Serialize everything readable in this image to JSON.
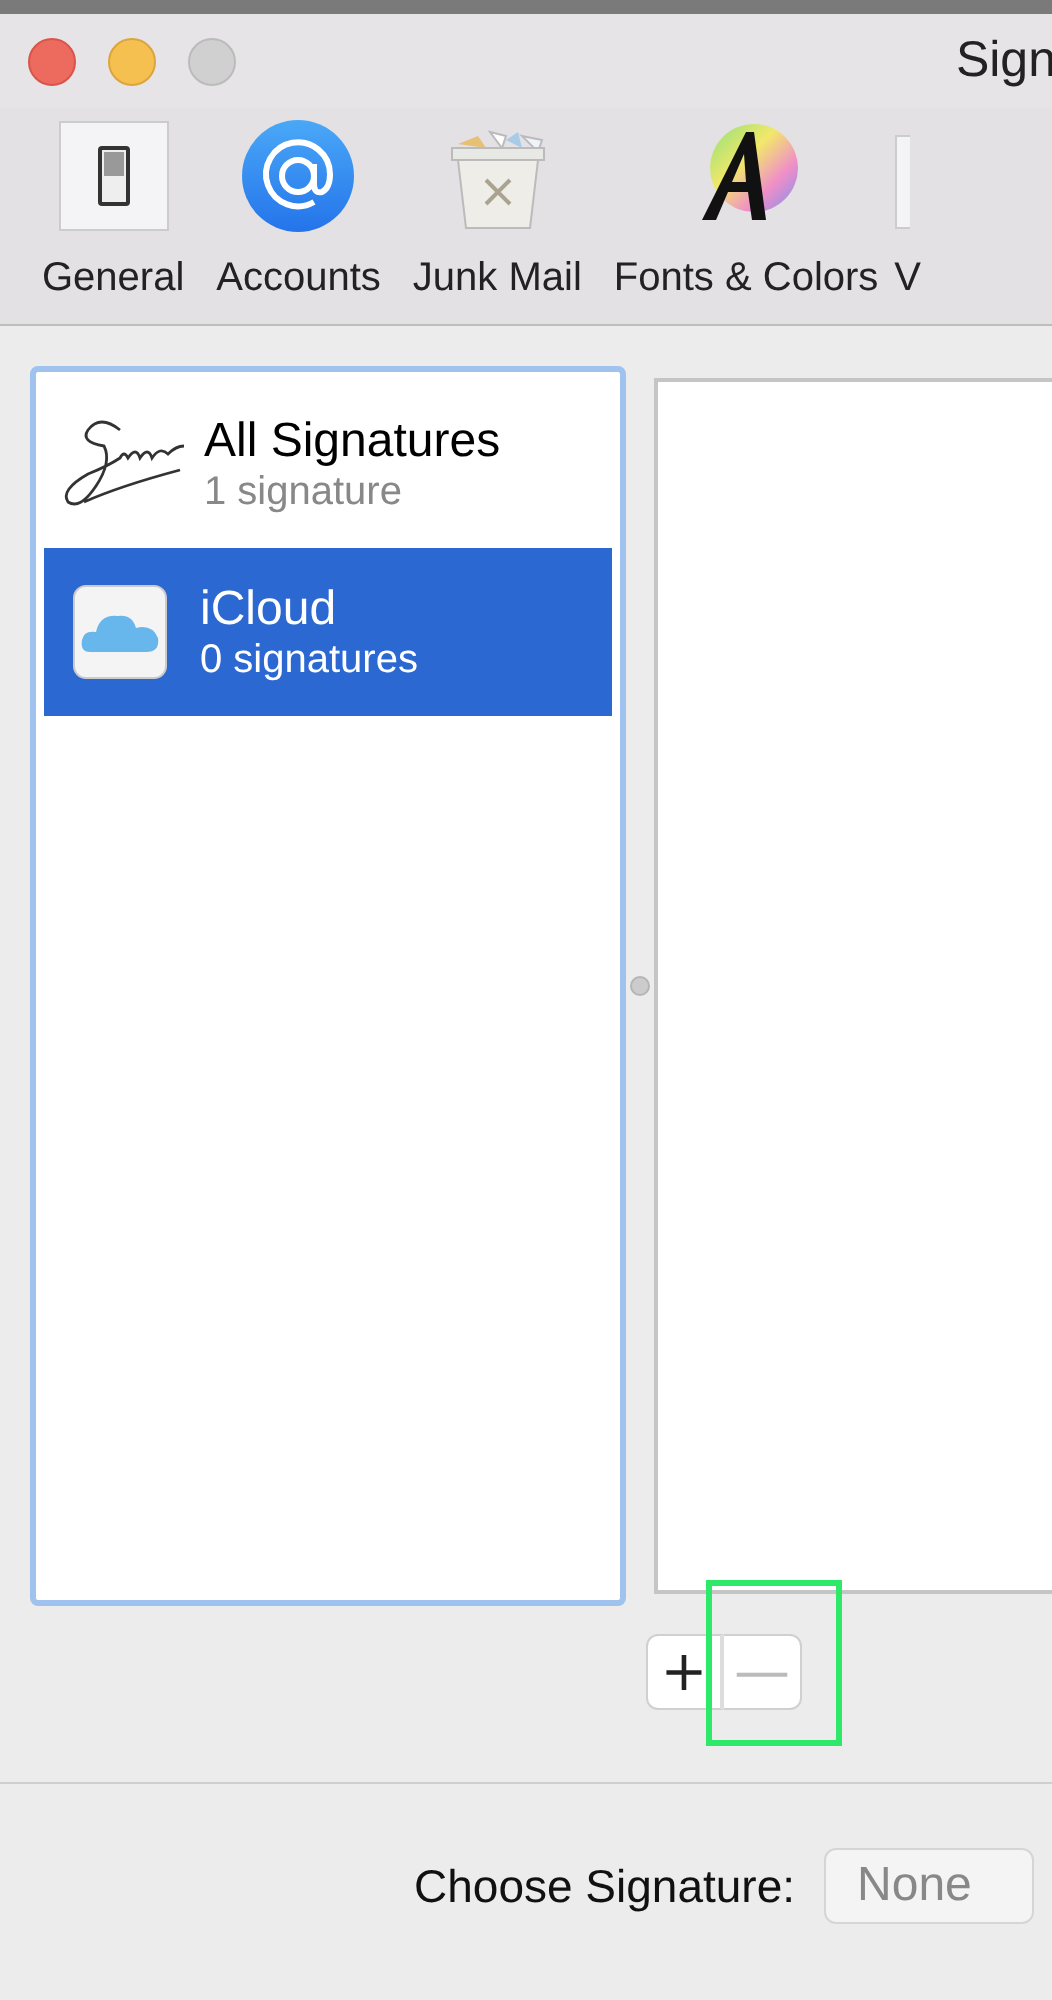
{
  "window": {
    "title": "Sign"
  },
  "toolbar": [
    {
      "label": "General",
      "kind": "general",
      "selected": false
    },
    {
      "label": "Accounts",
      "kind": "accounts",
      "selected": false
    },
    {
      "label": "Junk Mail",
      "kind": "junk",
      "selected": false
    },
    {
      "label": "Fonts & Colors",
      "kind": "fonts",
      "selected": false
    },
    {
      "label": "V",
      "kind": "cut",
      "selected": false
    }
  ],
  "accounts": [
    {
      "name": "All Signatures",
      "count": "1 signature",
      "kind": "all",
      "selected": false
    },
    {
      "name": "iCloud",
      "count": "0 signatures",
      "kind": "icloud",
      "selected": true
    }
  ],
  "buttons": [
    {
      "label": "+",
      "disabled": false
    },
    {
      "label": "—",
      "disabled": true
    }
  ],
  "choose_signature": {
    "label": "Choose Signature:",
    "value": "None"
  }
}
